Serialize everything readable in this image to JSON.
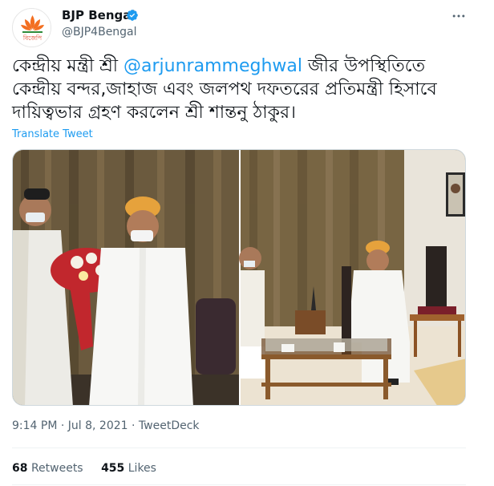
{
  "author": {
    "name": "BJP Bengal",
    "handle": "@BJP4Bengal",
    "avatar_text": "বিজেপি"
  },
  "tweet": {
    "text_part1": "কেন্দ্রীয় মন্ত্রী শ্রী ",
    "mention": "@arjunrammeghwal",
    "text_part2": " জীর উপস্থিতিতে কেন্দ্রীয় বন্দর,জাহাজ এবং জলপথ দফতরের প্রতিমন্ত্রী হিসাবে দায়িত্বভার গ্রহণ করলেন শ্রী শান্তনু ঠাকুর।",
    "translate": "Translate Tweet"
  },
  "meta": {
    "time": "9:14 PM",
    "sep1": " · ",
    "date": "Jul 8, 2021",
    "sep2": " · ",
    "source": "TweetDeck"
  },
  "stats": {
    "retweets_count": "68",
    "retweets_label": "Retweets",
    "likes_count": "455",
    "likes_label": "Likes"
  },
  "colors": {
    "accent": "#1d9bf0",
    "secondary_text": "#536471",
    "brand_orange": "#f36f21"
  },
  "icons": {
    "verified": "verified-badge-icon",
    "more": "more-options-icon",
    "logo": "lotus-icon"
  }
}
